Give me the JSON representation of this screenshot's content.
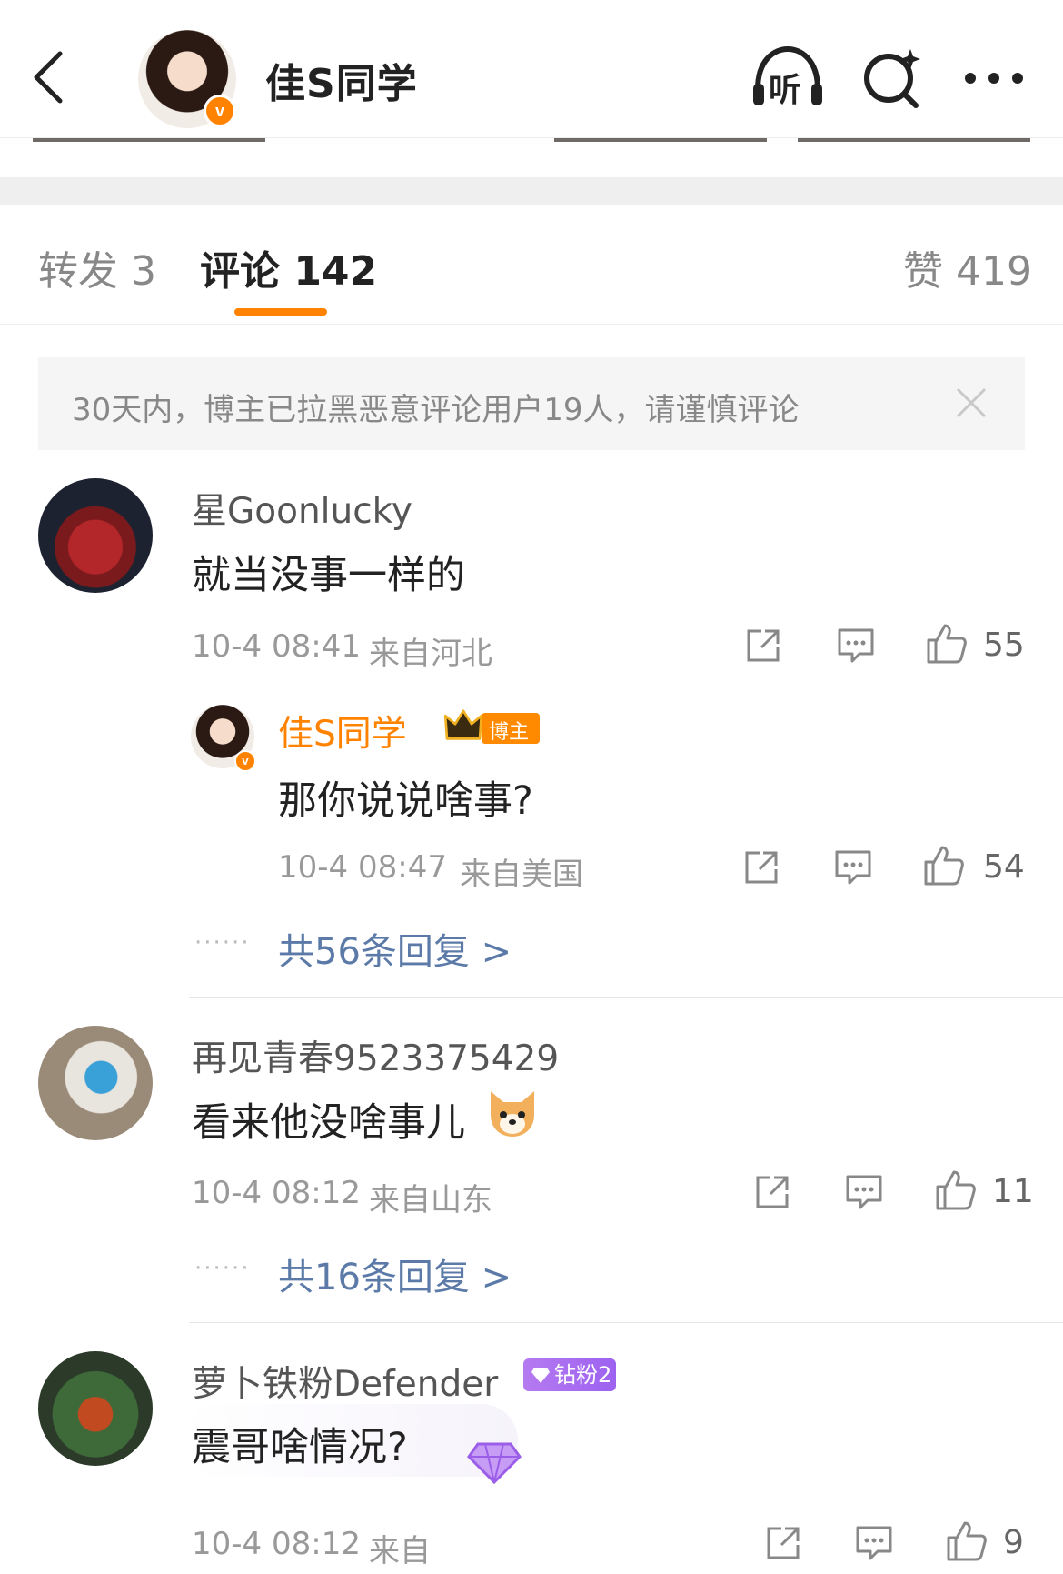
{
  "header": {
    "title": "佳S同学",
    "listen_label": "听",
    "back_icon": "chevron-left-icon",
    "search_icon": "search-sparkle-icon",
    "more_icon": "ellipsis-icon"
  },
  "tabs": [
    {
      "label": "转发 3",
      "active": false
    },
    {
      "label": "评论 142",
      "active": true
    },
    {
      "label": "赞 419",
      "active": false
    }
  ],
  "notice": {
    "text": "30天内，博主已拉黑恶意评论用户19人，请谨慎评论"
  },
  "comments": [
    {
      "username": "星Goonlucky",
      "text": "就当没事一样的",
      "time": "10-4 08:41",
      "location": "来自河北",
      "likes": "55",
      "reply": {
        "username": "佳S同学",
        "badge": "博主",
        "text": "那你说说啥事?",
        "time": "10-4 08:47",
        "location": "来自美国",
        "likes": "54"
      },
      "more_replies": "共56条回复 >"
    },
    {
      "username": "再见青春9523375429",
      "text": "看来他没啥事儿",
      "emoji": "dog-face-emoji",
      "time": "10-4 08:12",
      "location": "来自山东",
      "likes": "11",
      "more_replies": "共16条回复 >"
    },
    {
      "username": "萝卜铁粉Defender",
      "badge": "钻粉2",
      "text": "震哥啥情况?",
      "time": "10-4 08:12",
      "location": "来自",
      "likes": "9"
    }
  ],
  "colors": {
    "accent": "#ff8200",
    "link": "#5b7aa8",
    "fan_badge": "#a56cf0"
  }
}
